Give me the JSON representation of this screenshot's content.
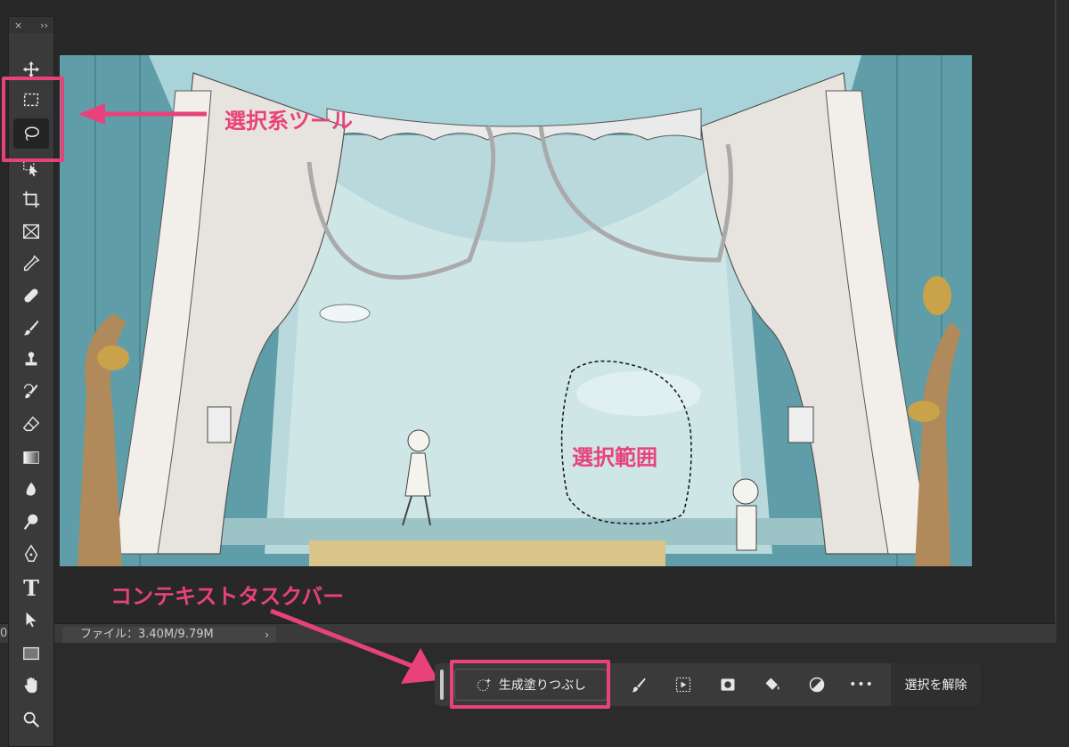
{
  "toolbar": {
    "close_label": "×",
    "expand_label": "››",
    "tools": [
      {
        "name": "move-tool",
        "icon": "move-icon"
      },
      {
        "name": "marquee-tool",
        "icon": "rect-marquee-icon"
      },
      {
        "name": "lasso-tool",
        "icon": "lasso-icon",
        "active": true
      },
      {
        "name": "object-select-tool",
        "icon": "object-select-icon"
      },
      {
        "name": "crop-tool",
        "icon": "crop-icon"
      },
      {
        "name": "frame-tool",
        "icon": "frame-icon"
      },
      {
        "name": "eyedropper-tool",
        "icon": "eyedropper-icon"
      },
      {
        "name": "healing-tool",
        "icon": "bandage-icon"
      },
      {
        "name": "brush-tool",
        "icon": "brush-icon"
      },
      {
        "name": "stamp-tool",
        "icon": "stamp-icon"
      },
      {
        "name": "history-brush-tool",
        "icon": "history-brush-icon"
      },
      {
        "name": "eraser-tool",
        "icon": "eraser-icon"
      },
      {
        "name": "gradient-tool",
        "icon": "gradient-icon"
      },
      {
        "name": "blur-tool",
        "icon": "blur-icon"
      },
      {
        "name": "dodge-tool",
        "icon": "dodge-icon"
      },
      {
        "name": "pen-tool",
        "icon": "pen-icon"
      },
      {
        "name": "type-tool",
        "icon": "type-icon",
        "glyph": "T"
      },
      {
        "name": "path-select-tool",
        "icon": "cursor-icon"
      },
      {
        "name": "shape-tool",
        "icon": "rectangle-icon"
      },
      {
        "name": "hand-tool",
        "icon": "hand-icon"
      },
      {
        "name": "zoom-tool",
        "icon": "zoom-icon"
      }
    ]
  },
  "annotations": {
    "selection_tools_label": "選択系ツール",
    "selection_area_label": "選択範囲",
    "context_taskbar_label": "コンテキストタスクバー",
    "accent_color": "#e8427a"
  },
  "status": {
    "left_fragment": "0",
    "file_info": "ファイル：3.40M/9.79M",
    "arrow": "›"
  },
  "taskbar": {
    "generative_fill_label": "生成塗りつぶし",
    "icons": [
      "brush-refine-icon",
      "select-subject-icon",
      "mask-icon",
      "fill-bucket-icon",
      "adjustment-icon",
      "more-icon"
    ],
    "more_label": "•••",
    "deselect_label": "選択を解除"
  }
}
